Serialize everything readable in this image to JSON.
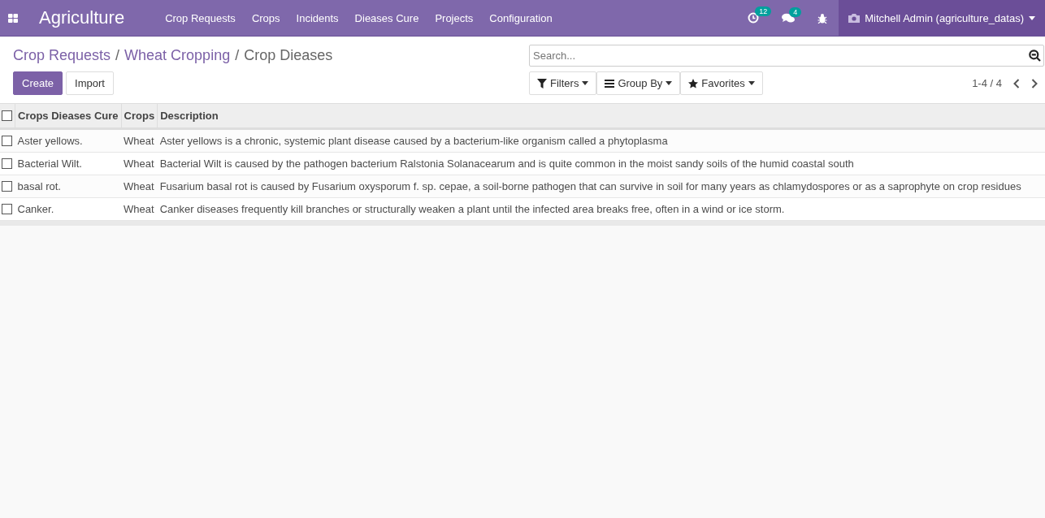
{
  "navbar": {
    "app_title": "Agriculture",
    "menu": [
      "Crop Requests",
      "Crops",
      "Incidents",
      "Dieases Cure",
      "Projects",
      "Configuration"
    ],
    "activity_count": "12",
    "message_count": "4",
    "user": "Mitchell Admin (agriculture_datas)"
  },
  "breadcrumbs": [
    {
      "label": "Crop Requests",
      "kind": "link"
    },
    {
      "separator": "/",
      "label": "Wheat Cropping",
      "kind": "link"
    },
    {
      "separator": "/",
      "label": "Crop Dieases",
      "kind": "current"
    }
  ],
  "buttons": [
    {
      "label": "Create",
      "kind": "primary"
    },
    {
      "label": "Import",
      "kind": "secondary"
    }
  ],
  "search": {
    "placeholder": "Search..."
  },
  "search_options": [
    {
      "label": "Filters",
      "kind": "filter"
    },
    {
      "label": "Group By",
      "kind": "group"
    },
    {
      "label": "Favorites",
      "kind": "star"
    }
  ],
  "pager": "1-4 / 4",
  "table": {
    "select_all": {
      "checked": false
    },
    "columns": [
      "Crops Dieases Cure",
      "Crops",
      "Description"
    ],
    "rows": [
      {
        "selected": false,
        "cells": [
          "Aster yellows.",
          "Wheat",
          "Aster yellows is a chronic, systemic plant disease caused by a bacterium-like organism called a phytoplasma"
        ]
      },
      {
        "selected": false,
        "cells": [
          "Bacterial Wilt.",
          "Wheat",
          "Bacterial Wilt is caused by the pathogen bacterium Ralstonia Solanacearum and is quite common in the moist sandy soils of the humid coastal south"
        ]
      },
      {
        "selected": false,
        "cells": [
          "basal rot.",
          "Wheat",
          "Fusarium basal rot is caused by Fusarium oxysporum f. sp. cepae, a soil-borne pathogen that can survive in soil for many years as chlamydospores or as a saprophyte on crop residues"
        ]
      },
      {
        "selected": false,
        "cells": [
          "Canker.",
          "Wheat",
          "Canker diseases frequently kill branches or structurally weaken a plant until the infected area breaks free, often in a wind or ice storm."
        ]
      }
    ]
  }
}
